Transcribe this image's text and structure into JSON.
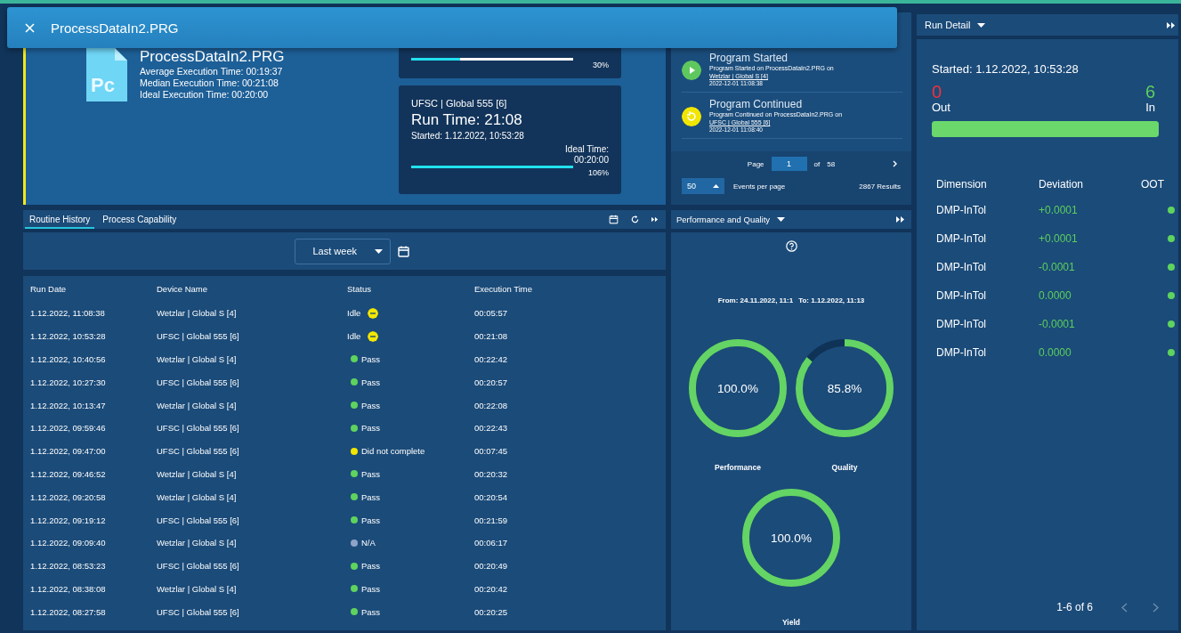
{
  "header": {
    "title": "ProcessDataIn2.PRG"
  },
  "program": {
    "icon_label": "Pc",
    "name": "ProcessDataIn2.PRG",
    "stats": [
      "Average Execution Time: 00:19:37",
      "Median Execution Time: 00:21:08",
      "Ideal Execution Time: 00:20:00"
    ]
  },
  "run_tiles": [
    {
      "percent": "30%",
      "level": 0.3
    },
    {
      "device": "UFSC | Global 555 [6]",
      "run_time": "Run Time: 21:08",
      "started": "Started: 1.12.2022, 10:53:28",
      "ideal_label": "Ideal Time:",
      "ideal_time": "00:20:00",
      "percent": "106%",
      "level": 1
    }
  ],
  "events": {
    "items": [
      {
        "kind": "started",
        "title": "Program Started",
        "text": "Program Started on ProcessDataIn2.PRG on",
        "link": "Wetzlar | Global S [4]",
        "time": "2022-12-01 11:08:38"
      },
      {
        "kind": "continued",
        "title": "Program Continued",
        "text": "Program Continued on ProcessDataIn2.PRG on",
        "link": "UFSC | Global 555 [6]",
        "time": "2022-12-01 11:08:40"
      }
    ],
    "page_label": "Page",
    "page": "1",
    "of_label": "of",
    "pages": "58",
    "per_page": "50",
    "per_page_label": "Events per page",
    "results": "2867 Results"
  },
  "history": {
    "tabs": [
      {
        "label": "Routine History",
        "selected": true
      },
      {
        "label": "Process Capability",
        "selected": false
      }
    ],
    "filter": "Last week",
    "columns": [
      "Run Date",
      "Device Name",
      "Status",
      "Execution Time"
    ],
    "rows": [
      {
        "run_date": "1.12.2022, 11:08:38",
        "device": "Wetzlar | Global S [4]",
        "status": {
          "kind": "idle",
          "label": "Idle",
          "color": "#f2e600"
        },
        "execution_time": "00:05:57"
      },
      {
        "run_date": "1.12.2022, 10:53:28",
        "device": "UFSC | Global 555 [6]",
        "status": {
          "kind": "idle",
          "label": "Idle",
          "color": "#f2e600"
        },
        "execution_time": "00:21:08"
      },
      {
        "run_date": "1.12.2022, 10:40:56",
        "device": "Wetzlar | Global S [4]",
        "status": {
          "kind": "dot",
          "label": "Pass",
          "color": "#5ed35e"
        },
        "execution_time": "00:22:42"
      },
      {
        "run_date": "1.12.2022, 10:27:30",
        "device": "UFSC | Global 555 [6]",
        "status": {
          "kind": "dot",
          "label": "Pass",
          "color": "#5ed35e"
        },
        "execution_time": "00:20:57"
      },
      {
        "run_date": "1.12.2022, 10:13:47",
        "device": "Wetzlar | Global S [4]",
        "status": {
          "kind": "dot",
          "label": "Pass",
          "color": "#5ed35e"
        },
        "execution_time": "00:22:08"
      },
      {
        "run_date": "1.12.2022, 09:59:46",
        "device": "UFSC | Global 555 [6]",
        "status": {
          "kind": "dot",
          "label": "Pass",
          "color": "#5ed35e"
        },
        "execution_time": "00:22:43"
      },
      {
        "run_date": "1.12.2022, 09:47:00",
        "device": "UFSC | Global 555 [6]",
        "status": {
          "kind": "dot",
          "label": "Did not complete",
          "color": "#f2e600"
        },
        "execution_time": "00:07:45"
      },
      {
        "run_date": "1.12.2022, 09:46:52",
        "device": "Wetzlar | Global S [4]",
        "status": {
          "kind": "dot",
          "label": "Pass",
          "color": "#5ed35e"
        },
        "execution_time": "00:20:32"
      },
      {
        "run_date": "1.12.2022, 09:20:58",
        "device": "Wetzlar | Global S [4]",
        "status": {
          "kind": "dot",
          "label": "Pass",
          "color": "#5ed35e"
        },
        "execution_time": "00:20:54"
      },
      {
        "run_date": "1.12.2022, 09:19:12",
        "device": "UFSC | Global 555 [6]",
        "status": {
          "kind": "dot",
          "label": "Pass",
          "color": "#5ed35e"
        },
        "execution_time": "00:21:59"
      },
      {
        "run_date": "1.12.2022, 09:09:40",
        "device": "Wetzlar | Global S [4]",
        "status": {
          "kind": "dot",
          "label": "N/A",
          "color": "#8fa3c8"
        },
        "execution_time": "00:06:17"
      },
      {
        "run_date": "1.12.2022, 08:53:23",
        "device": "UFSC | Global 555 [6]",
        "status": {
          "kind": "dot",
          "label": "Pass",
          "color": "#5ed35e"
        },
        "execution_time": "00:20:49"
      },
      {
        "run_date": "1.12.2022, 08:38:08",
        "device": "Wetzlar | Global S [4]",
        "status": {
          "kind": "dot",
          "label": "Pass",
          "color": "#5ed35e"
        },
        "execution_time": "00:20:42"
      },
      {
        "run_date": "1.12.2022, 08:27:58",
        "device": "UFSC | Global 555 [6]",
        "status": {
          "kind": "dot",
          "label": "Pass",
          "color": "#5ed35e"
        },
        "execution_time": "00:20:25"
      }
    ]
  },
  "performance": {
    "title": "Performance and Quality",
    "from": "From: 24.11.2022, 11:1",
    "to": "To: 1.12.2022, 11:13",
    "gauges": [
      {
        "label": "Performance",
        "value": "100.0%",
        "level": 1
      },
      {
        "label": "Quality",
        "value": "85.8%",
        "level": 0.858
      },
      {
        "label": "Yield",
        "value": "100.0%",
        "level": 1
      }
    ]
  },
  "run_detail": {
    "title": "Run Detail",
    "started": "Started: 1.12.2022, 10:53:28",
    "out_count": "0",
    "out_label": "Out",
    "in_count": "6",
    "in_label": "In",
    "level": 1,
    "columns": [
      "Dimension",
      "Deviation",
      "OOT"
    ],
    "rows": [
      {
        "dimension": "DMP-InTol",
        "deviation": "+0.0001",
        "color": "#5ed35e"
      },
      {
        "dimension": "DMP-InTol",
        "deviation": "+0.0001",
        "color": "#5ed35e"
      },
      {
        "dimension": "DMP-InTol",
        "deviation": "-0.0001",
        "color": "#5ed35e"
      },
      {
        "dimension": "DMP-InTol",
        "deviation": "0.0000",
        "color": "#5ed35e"
      },
      {
        "dimension": "DMP-InTol",
        "deviation": "-0.0001",
        "color": "#5ed35e"
      },
      {
        "dimension": "DMP-InTol",
        "deviation": "0.0000",
        "color": "#5ed35e"
      }
    ],
    "pagination": "1-6 of 6"
  }
}
